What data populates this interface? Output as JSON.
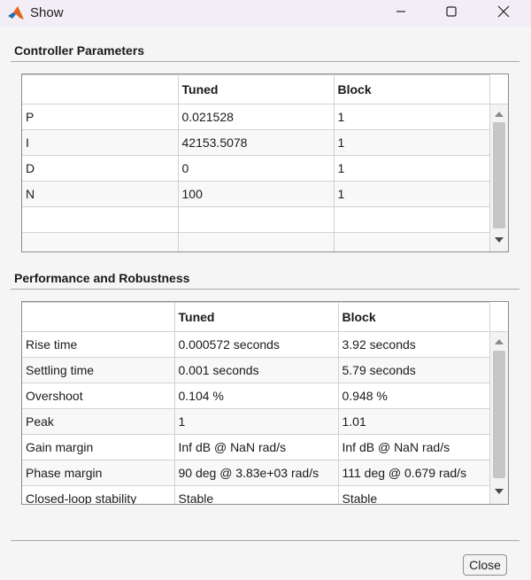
{
  "window": {
    "title": "Show"
  },
  "controller": {
    "title": "Controller Parameters",
    "columns": [
      "",
      "Tuned",
      "Block"
    ],
    "rows": [
      [
        "P",
        "0.021528",
        "1"
      ],
      [
        "I",
        "42153.5078",
        "1"
      ],
      [
        "D",
        "0",
        "1"
      ],
      [
        "N",
        "100",
        "1"
      ],
      [
        "",
        "",
        ""
      ],
      [
        "",
        "",
        ""
      ]
    ]
  },
  "performance": {
    "title": "Performance and Robustness",
    "columns": [
      "",
      "Tuned",
      "Block"
    ],
    "rows": [
      [
        "Rise time",
        "0.000572 seconds",
        "3.92 seconds"
      ],
      [
        "Settling time",
        "0.001 seconds",
        "5.79 seconds"
      ],
      [
        "Overshoot",
        "0.104 %",
        "0.948 %"
      ],
      [
        "Peak",
        "1",
        "1.01"
      ],
      [
        "Gain margin",
        "Inf dB @ NaN rad/s",
        "Inf dB @ NaN rad/s"
      ],
      [
        "Phase margin",
        "90 deg @ 3.83e+03 rad/s",
        "111 deg @ 0.679 rad/s"
      ],
      [
        "Closed-loop stability",
        "Stable",
        "Stable"
      ]
    ]
  },
  "footer": {
    "close_label": "Close"
  },
  "colors": {
    "titlebar": "#f3eef5",
    "client": "#f6f5f5",
    "grid": "#d2d2d2",
    "scroll_thumb": "#c6c6c6"
  },
  "icons": [
    "matlab-icon",
    "minimize-icon",
    "maximize-icon",
    "close-icon",
    "scroll-up-icon",
    "scroll-down-icon"
  ]
}
